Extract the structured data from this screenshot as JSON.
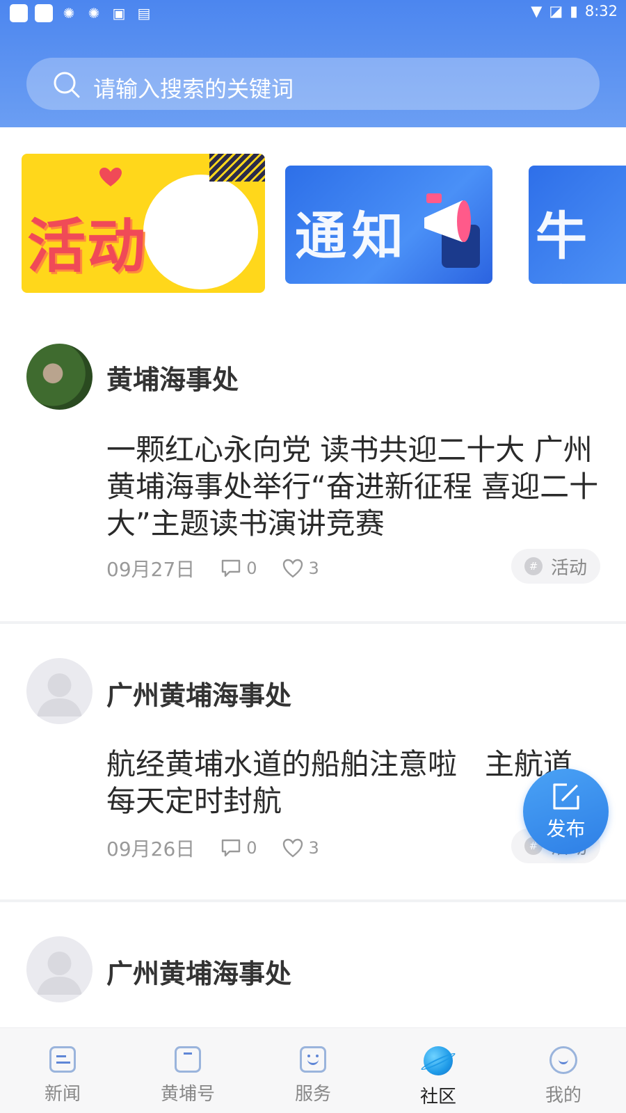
{
  "status_bar": {
    "time": "8:32",
    "icons": [
      "app-icon",
      "app-icon",
      "shutter-icon",
      "shutter-icon",
      "image-icon",
      "font-icon",
      "wifi-icon",
      "no-signal-icon",
      "battery-charging-icon"
    ]
  },
  "search": {
    "placeholder": "请输入搜索的关键词",
    "icon": "search-icon"
  },
  "banners": [
    {
      "label": "活动",
      "icon": "heart-icon"
    },
    {
      "label": "通知",
      "icon": "megaphone-icon"
    },
    {
      "label": "牛企"
    }
  ],
  "posts": [
    {
      "author": "黄埔海事处",
      "avatar": "garden-stone-photo",
      "title": "一颗红心永向党 读书共迎二十大 广州黄埔海事处举行“奋进新征程 喜迎二十大”主题读书演讲竞赛",
      "date": "09月27日",
      "comments": "0",
      "likes": "3",
      "tag": "活动"
    },
    {
      "author": "广州黄埔海事处",
      "avatar": "default-avatar",
      "title": "航经黄埔水道的船舶注意啦   主航道每天定时封航",
      "date": "09月26日",
      "comments": "0",
      "likes": "3",
      "tag": "活动"
    },
    {
      "author": "广州黄埔海事处",
      "avatar": "default-avatar"
    }
  ],
  "fab": {
    "label": "发布",
    "icon": "edit-icon"
  },
  "bottom_nav": [
    {
      "label": "新闻",
      "icon": "news-icon",
      "active": false
    },
    {
      "label": "黄埔号",
      "icon": "bookmark-icon",
      "active": false
    },
    {
      "label": "服务",
      "icon": "smile-box-icon",
      "active": false
    },
    {
      "label": "社区",
      "icon": "planet-icon",
      "active": true
    },
    {
      "label": "我的",
      "icon": "profile-icon",
      "active": false
    }
  ],
  "colors": {
    "header": "#4c86ef",
    "accent": "#2e7fe6",
    "tag_bg": "#f3f3f5",
    "text_secondary": "#999999"
  }
}
